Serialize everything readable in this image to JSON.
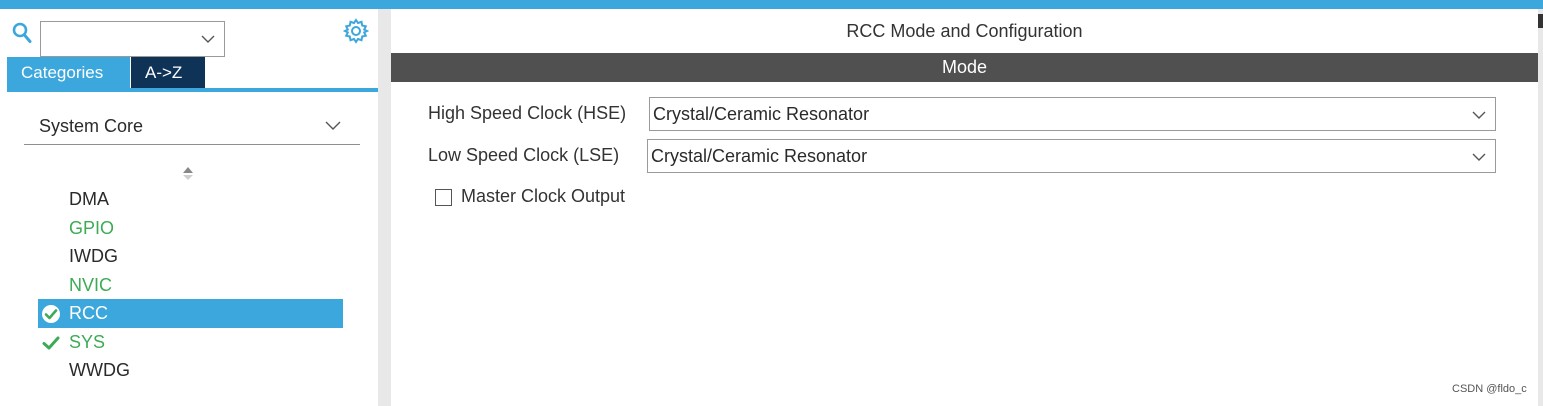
{
  "left_panel": {
    "search": {
      "value": ""
    },
    "tabs": [
      {
        "label": "Categories",
        "active": true
      },
      {
        "label": "A->Z",
        "active": false
      }
    ],
    "category": {
      "label": "System Core"
    },
    "items": [
      {
        "label": "DMA",
        "status": "none"
      },
      {
        "label": "GPIO",
        "status": "configured"
      },
      {
        "label": "IWDG",
        "status": "none"
      },
      {
        "label": "NVIC",
        "status": "configured"
      },
      {
        "label": "RCC",
        "status": "selected-ok"
      },
      {
        "label": "SYS",
        "status": "ok"
      },
      {
        "label": "WWDG",
        "status": "none"
      }
    ]
  },
  "right_panel": {
    "title": "RCC Mode and Configuration",
    "section": "Mode",
    "fields": [
      {
        "label": "High Speed Clock (HSE)",
        "value": "Crystal/Ceramic Resonator"
      },
      {
        "label": "Low Speed Clock (LSE)",
        "value": "Crystal/Ceramic Resonator"
      }
    ],
    "checkbox": {
      "label": "Master Clock Output",
      "checked": false
    },
    "watermark": "CSDN @fldo_c"
  },
  "colors": {
    "accent": "#3ca7dc",
    "dark_tab": "#0f3357",
    "green": "#3dab55",
    "mode_bar": "#505050"
  }
}
